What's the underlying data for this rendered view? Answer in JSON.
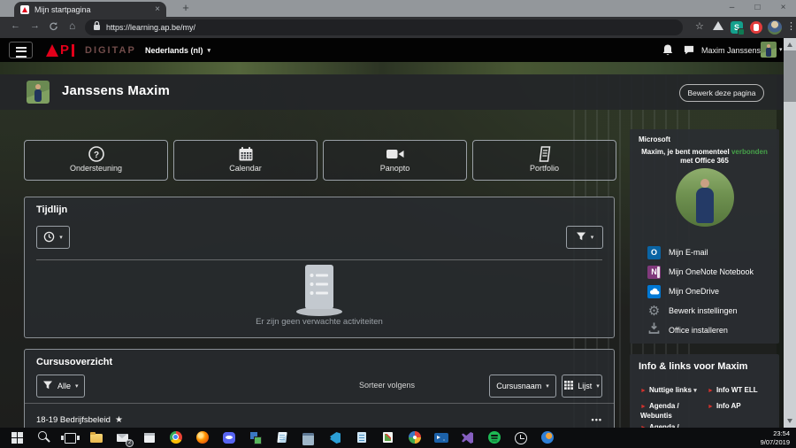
{
  "glyphs": {
    "caret_down": "▾",
    "ellipsis_menu": "•••",
    "star_filled": "★",
    "star_outline": "☆",
    "back_arrow": "←",
    "forward_arrow": "→",
    "home": "⌂",
    "menu_dots": "⋮",
    "gear": "⚙",
    "plus": "+",
    "close": "×",
    "minimize": "–",
    "maximize": "□",
    "marker": "►",
    "outlook_letter": "O",
    "onenote_letter": "N"
  },
  "browser": {
    "tab_title": "Mijn startpagina",
    "url": "https://learning.ap.be/my/",
    "extension_s_label": "S"
  },
  "navbar": {
    "brand": "DIGITAP",
    "language": "Nederlands (nl)",
    "user_name": "Maxim Janssens"
  },
  "page_header": {
    "title": "Janssens Maxim",
    "edit_button": "Bewerk deze pagina"
  },
  "quick_links": [
    {
      "label": "Ondersteuning",
      "icon": "question-circle"
    },
    {
      "label": "Calendar",
      "icon": "calendar"
    },
    {
      "label": "Panopto",
      "icon": "video-camera"
    },
    {
      "label": "Portfolio",
      "icon": "book"
    }
  ],
  "timeline": {
    "title": "Tijdlijn",
    "empty_message": "Er zijn geen verwachte activiteiten"
  },
  "course_overview": {
    "title": "Cursusoverzicht",
    "filter_label": "Alle",
    "sort_label": "Sorteer volgens",
    "sort_value": "Cursusnaam",
    "view_value": "Lijst",
    "courses": [
      {
        "name": "18-19 Bedrijfsbeleid",
        "starred": true
      }
    ]
  },
  "sidebar": {
    "microsoft": {
      "title": "Microsoft",
      "status_prefix": "Maxim, je bent momenteel ",
      "status_highlight": "verbonden",
      "status_suffix": " met Office 365",
      "links": [
        {
          "label": "Mijn E-mail",
          "icon": "outlook"
        },
        {
          "label": "Mijn OneNote Notebook",
          "icon": "onenote"
        },
        {
          "label": "Mijn OneDrive",
          "icon": "onedrive"
        },
        {
          "label": "Bewerk instellingen",
          "icon": "gear"
        },
        {
          "label": "Office installeren",
          "icon": "download"
        }
      ]
    },
    "info_links": {
      "title": "Info & links voor Maxim",
      "links": [
        {
          "label": "Nuttige links",
          "has_caret": true
        },
        {
          "label": "Info WT ELL"
        },
        {
          "label": "Agenda / Webuntis"
        },
        {
          "label": "Info AP"
        },
        {
          "label": "Agenda /"
        }
      ]
    }
  },
  "taskbar": {
    "time": "23:54",
    "date": "9/07/2019",
    "mail_badge": "2",
    "icons": [
      "start",
      "search",
      "task-view",
      "file-explorer",
      "mail",
      "calendar",
      "chrome",
      "firefox",
      "discord",
      "security-app",
      "notes-app",
      "remote-desktop",
      "vscode",
      "editor-app",
      "reader-app",
      "media-app",
      "powershell",
      "visual-studio",
      "spotify",
      "alarm-clock",
      "globe-app"
    ]
  },
  "colors": {
    "ap_red": "#e2001a",
    "connected_green": "#46a049"
  }
}
